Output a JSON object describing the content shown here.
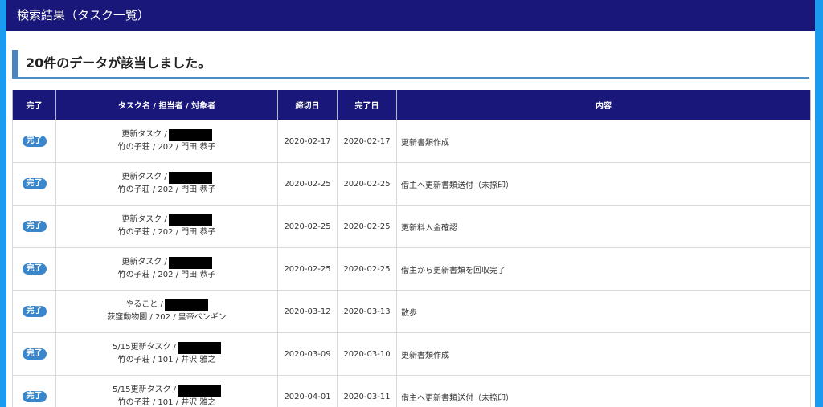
{
  "header": {
    "title": "検索結果（タスク一覧）"
  },
  "summary": {
    "text": "20件のデータが該当しました。"
  },
  "table": {
    "columns": {
      "done": "完了",
      "task": "タスク名 / 担当者 / 対象者",
      "deadline": "締切日",
      "completed": "完了日",
      "content": "内容"
    },
    "rows": [
      {
        "status": "完了",
        "task_name": "更新タスク /",
        "target": "竹の子荘 / 202 / 門田 恭子",
        "deadline": "2020-02-17",
        "completed": "2020-02-17",
        "content": "更新書類作成"
      },
      {
        "status": "完了",
        "task_name": "更新タスク /",
        "target": "竹の子荘 / 202 / 門田 恭子",
        "deadline": "2020-02-25",
        "completed": "2020-02-25",
        "content": "借主へ更新書類送付（未捺印）"
      },
      {
        "status": "完了",
        "task_name": "更新タスク /",
        "target": "竹の子荘 / 202 / 門田 恭子",
        "deadline": "2020-02-25",
        "completed": "2020-02-25",
        "content": "更新料入金確認"
      },
      {
        "status": "完了",
        "task_name": "更新タスク /",
        "target": "竹の子荘 / 202 / 門田 恭子",
        "deadline": "2020-02-25",
        "completed": "2020-02-25",
        "content": "借主から更新書類を回収完了"
      },
      {
        "status": "完了",
        "task_name": "やること /",
        "target": "荻窪動物園 / 202 / 皇帝ペンギン",
        "deadline": "2020-03-12",
        "completed": "2020-03-13",
        "content": "散歩"
      },
      {
        "status": "完了",
        "task_name": "5/15更新タスク /",
        "target": "竹の子荘 / 101 / 井沢 雅之",
        "deadline": "2020-03-09",
        "completed": "2020-03-10",
        "content": "更新書類作成"
      },
      {
        "status": "完了",
        "task_name": "5/15更新タスク /",
        "target": "竹の子荘 / 101 / 井沢 雅之",
        "deadline": "2020-04-01",
        "completed": "2020-03-11",
        "content": "借主へ更新書類送付（未捺印）"
      }
    ]
  }
}
